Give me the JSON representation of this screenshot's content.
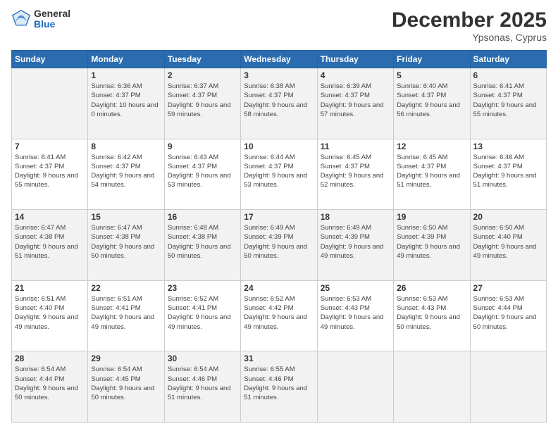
{
  "header": {
    "logo_general": "General",
    "logo_blue": "Blue",
    "month_title": "December 2025",
    "location": "Ypsonas, Cyprus"
  },
  "weekdays": [
    "Sunday",
    "Monday",
    "Tuesday",
    "Wednesday",
    "Thursday",
    "Friday",
    "Saturday"
  ],
  "weeks": [
    [
      {
        "day": "",
        "sunrise": "",
        "sunset": "",
        "daylight": ""
      },
      {
        "day": "1",
        "sunrise": "Sunrise: 6:36 AM",
        "sunset": "Sunset: 4:37 PM",
        "daylight": "Daylight: 10 hours and 0 minutes."
      },
      {
        "day": "2",
        "sunrise": "Sunrise: 6:37 AM",
        "sunset": "Sunset: 4:37 PM",
        "daylight": "Daylight: 9 hours and 59 minutes."
      },
      {
        "day": "3",
        "sunrise": "Sunrise: 6:38 AM",
        "sunset": "Sunset: 4:37 PM",
        "daylight": "Daylight: 9 hours and 58 minutes."
      },
      {
        "day": "4",
        "sunrise": "Sunrise: 6:39 AM",
        "sunset": "Sunset: 4:37 PM",
        "daylight": "Daylight: 9 hours and 57 minutes."
      },
      {
        "day": "5",
        "sunrise": "Sunrise: 6:40 AM",
        "sunset": "Sunset: 4:37 PM",
        "daylight": "Daylight: 9 hours and 56 minutes."
      },
      {
        "day": "6",
        "sunrise": "Sunrise: 6:41 AM",
        "sunset": "Sunset: 4:37 PM",
        "daylight": "Daylight: 9 hours and 55 minutes."
      }
    ],
    [
      {
        "day": "7",
        "sunrise": "Sunrise: 6:41 AM",
        "sunset": "Sunset: 4:37 PM",
        "daylight": "Daylight: 9 hours and 55 minutes."
      },
      {
        "day": "8",
        "sunrise": "Sunrise: 6:42 AM",
        "sunset": "Sunset: 4:37 PM",
        "daylight": "Daylight: 9 hours and 54 minutes."
      },
      {
        "day": "9",
        "sunrise": "Sunrise: 6:43 AM",
        "sunset": "Sunset: 4:37 PM",
        "daylight": "Daylight: 9 hours and 53 minutes."
      },
      {
        "day": "10",
        "sunrise": "Sunrise: 6:44 AM",
        "sunset": "Sunset: 4:37 PM",
        "daylight": "Daylight: 9 hours and 53 minutes."
      },
      {
        "day": "11",
        "sunrise": "Sunrise: 6:45 AM",
        "sunset": "Sunset: 4:37 PM",
        "daylight": "Daylight: 9 hours and 52 minutes."
      },
      {
        "day": "12",
        "sunrise": "Sunrise: 6:45 AM",
        "sunset": "Sunset: 4:37 PM",
        "daylight": "Daylight: 9 hours and 51 minutes."
      },
      {
        "day": "13",
        "sunrise": "Sunrise: 6:46 AM",
        "sunset": "Sunset: 4:37 PM",
        "daylight": "Daylight: 9 hours and 51 minutes."
      }
    ],
    [
      {
        "day": "14",
        "sunrise": "Sunrise: 6:47 AM",
        "sunset": "Sunset: 4:38 PM",
        "daylight": "Daylight: 9 hours and 51 minutes."
      },
      {
        "day": "15",
        "sunrise": "Sunrise: 6:47 AM",
        "sunset": "Sunset: 4:38 PM",
        "daylight": "Daylight: 9 hours and 50 minutes."
      },
      {
        "day": "16",
        "sunrise": "Sunrise: 6:48 AM",
        "sunset": "Sunset: 4:38 PM",
        "daylight": "Daylight: 9 hours and 50 minutes."
      },
      {
        "day": "17",
        "sunrise": "Sunrise: 6:49 AM",
        "sunset": "Sunset: 4:39 PM",
        "daylight": "Daylight: 9 hours and 50 minutes."
      },
      {
        "day": "18",
        "sunrise": "Sunrise: 6:49 AM",
        "sunset": "Sunset: 4:39 PM",
        "daylight": "Daylight: 9 hours and 49 minutes."
      },
      {
        "day": "19",
        "sunrise": "Sunrise: 6:50 AM",
        "sunset": "Sunset: 4:39 PM",
        "daylight": "Daylight: 9 hours and 49 minutes."
      },
      {
        "day": "20",
        "sunrise": "Sunrise: 6:50 AM",
        "sunset": "Sunset: 4:40 PM",
        "daylight": "Daylight: 9 hours and 49 minutes."
      }
    ],
    [
      {
        "day": "21",
        "sunrise": "Sunrise: 6:51 AM",
        "sunset": "Sunset: 4:40 PM",
        "daylight": "Daylight: 9 hours and 49 minutes."
      },
      {
        "day": "22",
        "sunrise": "Sunrise: 6:51 AM",
        "sunset": "Sunset: 4:41 PM",
        "daylight": "Daylight: 9 hours and 49 minutes."
      },
      {
        "day": "23",
        "sunrise": "Sunrise: 6:52 AM",
        "sunset": "Sunset: 4:41 PM",
        "daylight": "Daylight: 9 hours and 49 minutes."
      },
      {
        "day": "24",
        "sunrise": "Sunrise: 6:52 AM",
        "sunset": "Sunset: 4:42 PM",
        "daylight": "Daylight: 9 hours and 49 minutes."
      },
      {
        "day": "25",
        "sunrise": "Sunrise: 6:53 AM",
        "sunset": "Sunset: 4:43 PM",
        "daylight": "Daylight: 9 hours and 49 minutes."
      },
      {
        "day": "26",
        "sunrise": "Sunrise: 6:53 AM",
        "sunset": "Sunset: 4:43 PM",
        "daylight": "Daylight: 9 hours and 50 minutes."
      },
      {
        "day": "27",
        "sunrise": "Sunrise: 6:53 AM",
        "sunset": "Sunset: 4:44 PM",
        "daylight": "Daylight: 9 hours and 50 minutes."
      }
    ],
    [
      {
        "day": "28",
        "sunrise": "Sunrise: 6:54 AM",
        "sunset": "Sunset: 4:44 PM",
        "daylight": "Daylight: 9 hours and 50 minutes."
      },
      {
        "day": "29",
        "sunrise": "Sunrise: 6:54 AM",
        "sunset": "Sunset: 4:45 PM",
        "daylight": "Daylight: 9 hours and 50 minutes."
      },
      {
        "day": "30",
        "sunrise": "Sunrise: 6:54 AM",
        "sunset": "Sunset: 4:46 PM",
        "daylight": "Daylight: 9 hours and 51 minutes."
      },
      {
        "day": "31",
        "sunrise": "Sunrise: 6:55 AM",
        "sunset": "Sunset: 4:46 PM",
        "daylight": "Daylight: 9 hours and 51 minutes."
      },
      {
        "day": "",
        "sunrise": "",
        "sunset": "",
        "daylight": ""
      },
      {
        "day": "",
        "sunrise": "",
        "sunset": "",
        "daylight": ""
      },
      {
        "day": "",
        "sunrise": "",
        "sunset": "",
        "daylight": ""
      }
    ]
  ]
}
